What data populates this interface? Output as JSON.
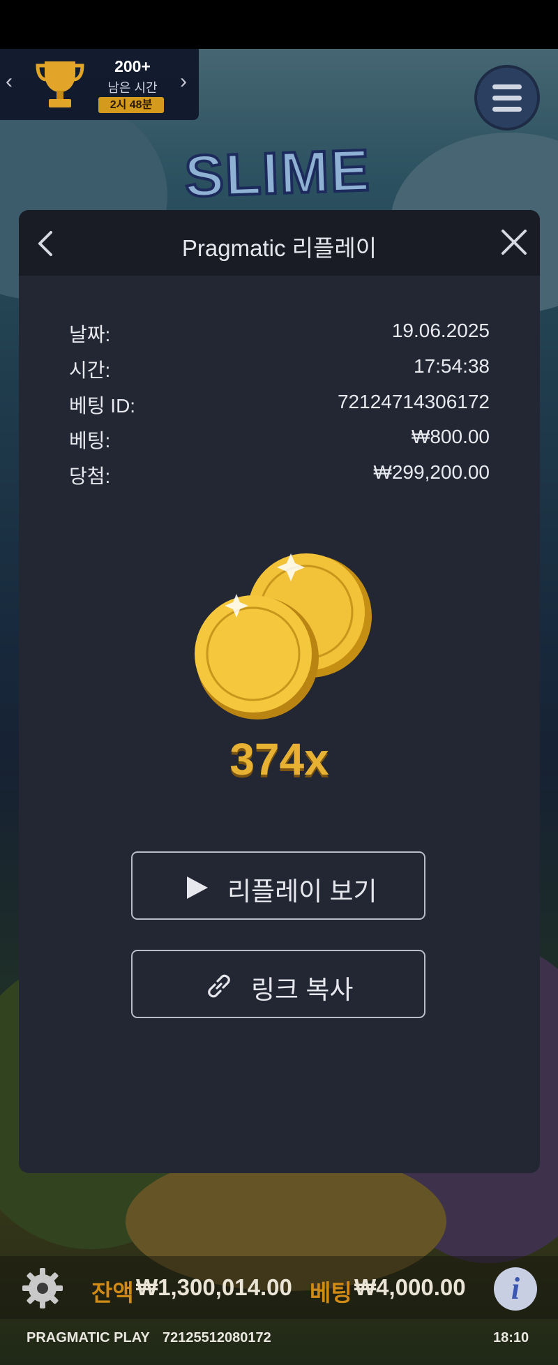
{
  "game": {
    "logo": "SLIME"
  },
  "tournament": {
    "count": "200+",
    "label": "남은 시간",
    "time": "2시 48분"
  },
  "modal": {
    "title": "Pragmatic 리플레이",
    "rows": [
      {
        "label": "날짜:",
        "value": "19.06.2025"
      },
      {
        "label": "시간:",
        "value": "17:54:38"
      },
      {
        "label": "베팅 ID:",
        "value": "72124714306172"
      },
      {
        "label": "베팅:",
        "value": "₩800.00"
      },
      {
        "label": "당첨:",
        "value": "₩299,200.00"
      }
    ],
    "multiplier": "374x",
    "watch_replay": "리플레이 보기",
    "copy_link": "링크 복사"
  },
  "bottom": {
    "balance_label": "잔액",
    "balance_value": "₩1,300,014.00",
    "bet_label": "베팅",
    "bet_value": "₩4,000.00",
    "provider": "PRAGMATIC PLAY",
    "round_id": "72125512080172",
    "clock": "18:10",
    "info_glyph": "i"
  },
  "colors": {
    "modal_bg": "#232633",
    "modal_header": "#191b25",
    "accent_gold": "#e7b234",
    "balance_label": "#d08b17"
  }
}
